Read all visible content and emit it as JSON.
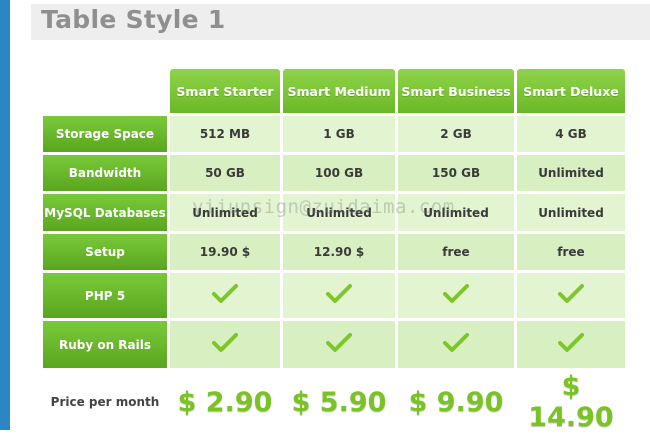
{
  "page": {
    "title": "Table Style 1"
  },
  "colors": {
    "accent_green": "#79c323",
    "header_green": "#6bb827",
    "cell_bg": "#e2f5d0",
    "left_bar_blue": "#2b86c3",
    "title_gray": "#8f8f8f"
  },
  "plans": [
    "Smart Starter",
    "Smart Medium",
    "Smart Business",
    "Smart Deluxe"
  ],
  "rows": [
    {
      "label": "Storage Space",
      "values": [
        "512 MB",
        "1 GB",
        "2 GB",
        "4 GB"
      ]
    },
    {
      "label": "Bandwidth",
      "values": [
        "50 GB",
        "100 GB",
        "150 GB",
        "Unlimited"
      ]
    },
    {
      "label": "MySQL Databases",
      "values": [
        "Unlimited",
        "Unlimited",
        "Unlimited",
        "Unlimited"
      ]
    },
    {
      "label": "Setup",
      "values": [
        "19.90 $",
        "12.90 $",
        "free",
        "free"
      ]
    },
    {
      "label": "PHP 5",
      "icon": "check-icon",
      "values": [
        true,
        true,
        true,
        true
      ]
    },
    {
      "label": "Ruby on Rails",
      "icon": "check-icon",
      "values": [
        true,
        true,
        true,
        true
      ]
    }
  ],
  "price_row": {
    "label": "Price per month",
    "prices": [
      "$ 2.90",
      "$ 5.90",
      "$ 9.90",
      "$ 14.90"
    ]
  },
  "watermark": "yijunsign@zuidaima.com"
}
